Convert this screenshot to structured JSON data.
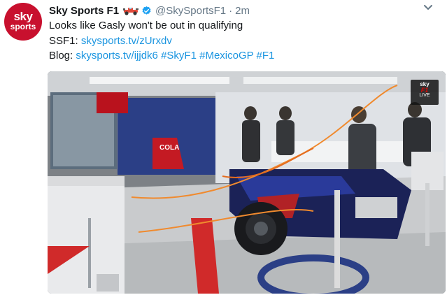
{
  "tweet": {
    "display_name": "Sky Sports F1",
    "handle": "@SkySportsF1",
    "separator": "·",
    "timestamp": "2m",
    "avatar": {
      "line1": "sky",
      "line2": "sports",
      "color": "#c8102e"
    },
    "icons": {
      "f1_car": "racing-car-emoji-icon",
      "verified": "verified-badge-icon",
      "more": "chevron-down-icon"
    },
    "body": {
      "line1": "Looks like Gasly won't be out in qualifying",
      "line2_prefix": "SSF1: ",
      "line2_link": "skysports.tv/zUrxdv",
      "line3_prefix": "Blog: ",
      "line3_link": "skysports.tv/ijjdk6",
      "hashtag1": "#SkyF1",
      "hashtag2": "#MexicoGP",
      "hashtag3": "#F1"
    },
    "media": {
      "description_tag": "garage-video-still",
      "broadcast_bug": {
        "brand": "sky",
        "subbrand": "F1",
        "status": "LIVE"
      },
      "sidepod_text": "COLA"
    },
    "colors": {
      "link": "#1b95e0",
      "muted": "#657786",
      "accent": "#c8102e"
    }
  }
}
